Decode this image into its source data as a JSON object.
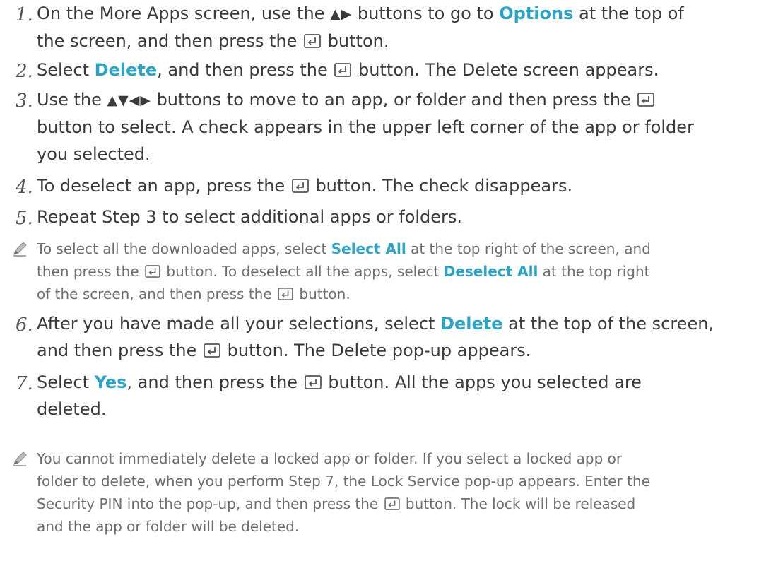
{
  "steps": [
    {
      "num": "1.",
      "a": "On the More Apps screen, use the ",
      "arrows": "▲▶",
      "b": " buttons to go to ",
      "hl": "Options",
      "c": " at the top of",
      "line2a": "the screen, and then press the ",
      "line2b": " button."
    },
    {
      "num": "2.",
      "a": "Select ",
      "hl": "Delete",
      "b": ", and then press the ",
      "c": " button. The Delete screen appears."
    },
    {
      "num": "3.",
      "a": "Use the ",
      "arrows": "▲▼◀▶",
      "b": " buttons to move to an app, or folder and then press the ",
      "line2": "button to select. A check appears in the upper left corner of the app or folder",
      "line3": "you selected."
    },
    {
      "num": "4.",
      "a": "To deselect an app, press the ",
      "b": " button. The check disappears."
    },
    {
      "num": "5.",
      "a": "Repeat Step 3 to select additional apps or folders."
    },
    {
      "num": "6.",
      "a": "After you have made all your selections, select ",
      "hl": "Delete",
      "b": " at the top of the screen,",
      "line2a": "and then press the ",
      "line2b": " button. The Delete pop-up appears."
    },
    {
      "num": "7.",
      "a": "Select ",
      "hl": "Yes",
      "b": ", and then press the ",
      "c": " button. All the apps you selected are",
      "line2": "deleted."
    }
  ],
  "notes": [
    {
      "a": "To select all the downloaded apps, select ",
      "hl1": "Select All",
      "b": " at the top right of the screen, and",
      "line2a": "then press the ",
      "line2b": " button. To deselect all the apps, select ",
      "hl2": "Deselect All",
      "line2c": " at the top right",
      "line3a": "of the screen, and then press the ",
      "line3b": " button."
    },
    {
      "line1": "You cannot immediately delete a locked app or folder. If you select a locked app or",
      "line2": "folder to delete, when you perform Step 7, the Lock Service pop-up appears. Enter the",
      "line3a": "Security PIN into the pop-up, and then press the ",
      "line3b": " button. The lock will be released",
      "line4": "and the app or folder will be deleted."
    }
  ],
  "icons": {
    "enter": "enter-button-icon",
    "pencil": "pencil-note-icon"
  },
  "colors": {
    "highlight": "#2aa3c6",
    "body": "#3a3a3a",
    "note": "#6e6e6e"
  }
}
